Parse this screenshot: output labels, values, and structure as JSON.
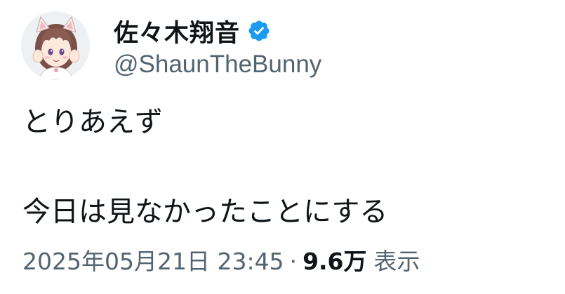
{
  "tweet": {
    "author": {
      "display_name": "佐々木翔音",
      "handle": "@ShaunTheBunny",
      "verified": true,
      "avatar_icon": "anime-girl-avatar-icon",
      "verified_icon": "verified-badge-icon"
    },
    "text_lines": [
      "とりあえず",
      "",
      "今日は見なかったことにする"
    ],
    "meta": {
      "datetime": "2025年05月21日 23:45",
      "separator": "·",
      "views_count": "9.6万",
      "views_label": "表示"
    }
  },
  "colors": {
    "text_primary": "#0f1419",
    "text_secondary": "#536471",
    "verified_blue": "#1d9bf0",
    "background": "#ffffff"
  }
}
